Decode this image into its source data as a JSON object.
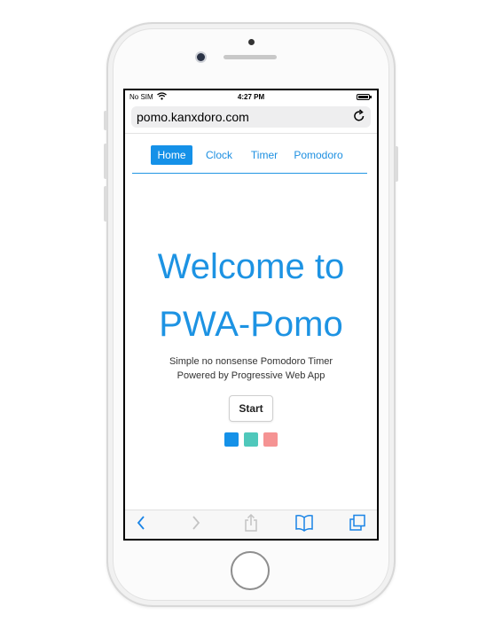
{
  "status_bar": {
    "carrier": "No SIM",
    "time": "4:27 PM",
    "wifi_icon": "wifi-icon",
    "battery_icon": "battery-icon"
  },
  "browser": {
    "url": "pomo.kanxdoro.com",
    "reload_icon": "reload-icon"
  },
  "nav": {
    "tabs": [
      {
        "label": "Home",
        "active": true
      },
      {
        "label": "Clock",
        "active": false
      },
      {
        "label": "Timer",
        "active": false
      },
      {
        "label": "Pomodoro",
        "active": false
      }
    ]
  },
  "main": {
    "title_line1": "Welcome to",
    "title_line2": "PWA-Pomo",
    "subtitle_line1": "Simple no nonsense Pomodoro Timer",
    "subtitle_line2": "Powered by Progressive Web App",
    "start_label": "Start",
    "theme_colors": [
      "#1591e8",
      "#4fc8bb",
      "#f59393"
    ]
  },
  "toolbar": {
    "icons": [
      "back-icon",
      "forward-icon",
      "share-icon",
      "bookmarks-icon",
      "tabs-icon"
    ]
  },
  "colors": {
    "accent": "#1591e8"
  }
}
